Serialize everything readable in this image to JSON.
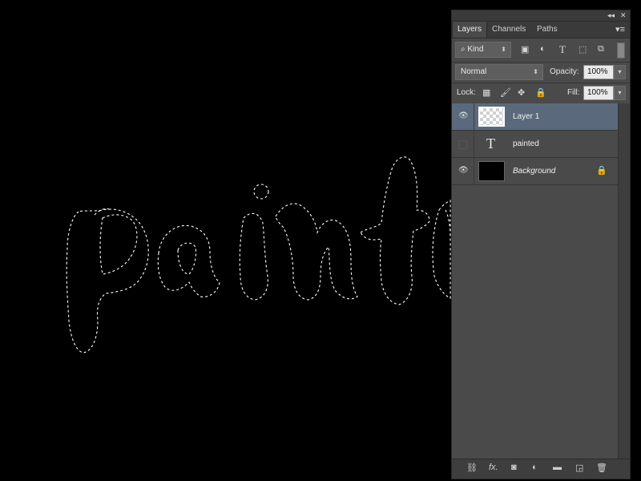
{
  "panel": {
    "tabs": [
      "Layers",
      "Channels",
      "Paths"
    ],
    "active_tab": "Layers",
    "filter_kind": "Kind",
    "blend_mode": "Normal",
    "opacity_label": "Opacity:",
    "opacity_value": "100%",
    "lock_label": "Lock:",
    "fill_label": "Fill:",
    "fill_value": "100%",
    "type_glyph": "T",
    "layers": [
      {
        "name": "Layer 1",
        "visible": true,
        "selected": true,
        "kind": "transparent"
      },
      {
        "name": "painted",
        "visible": false,
        "selected": false,
        "kind": "text"
      },
      {
        "name": "Background",
        "visible": true,
        "selected": false,
        "kind": "fill",
        "locked": true
      }
    ]
  },
  "canvas": {
    "selection_text": "painted",
    "background_color": "#000000"
  },
  "colors": {
    "panel_bg": "#4a4a4a",
    "selected_layer": "#5a6a7c",
    "marching_ants": "#ffffff"
  }
}
